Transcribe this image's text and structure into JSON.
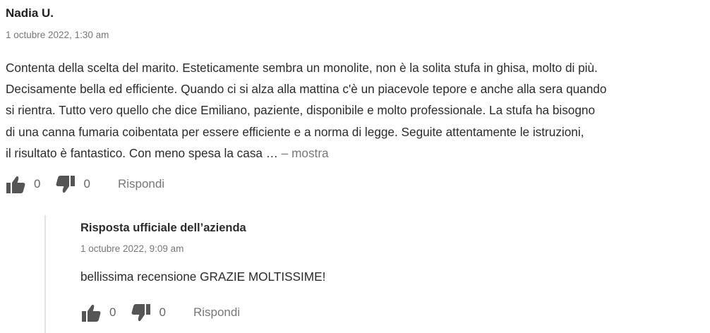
{
  "review": {
    "author": "Nadia U.",
    "date": "1 octubre 2022, 1:30 am",
    "text_lines": [
      "Contenta della scelta del marito. Esteticamente sembra un monolite, non è la solita stufa in ghisa, molto di più.",
      "Decisamente bella ed efficiente. Quando ci si alza alla mattina c'è un piacevole tepore e anche alla sera quando",
      "si rientra. Tutto vero quello che dice Emiliano, paziente, disponibile e molto professionale. La stufa ha bisogno",
      "di una canna fumaria coibentata per essere efficiente e a norma di legge. Seguite attentamente le istruzioni,",
      "il risultato è fantastico. Con meno spesa la casa …"
    ],
    "more_label": "– mostra",
    "likes": "0",
    "dislikes": "0",
    "reply_label": "Rispondi"
  },
  "response": {
    "author": "Risposta ufficiale dell’azienda",
    "date": "1 octubre 2022, 9:09 am",
    "text": "bellissima recensione GRAZIE MOLTISSIME!",
    "likes": "0",
    "dislikes": "0",
    "reply_label": "Rispondi"
  },
  "icons": {
    "like": "thumbs-up-icon",
    "dislike": "thumbs-down-icon"
  },
  "colors": {
    "text": "#2b2b2b",
    "muted": "#777777",
    "icon": "#555555",
    "thread_line": "#e3e3e3"
  }
}
